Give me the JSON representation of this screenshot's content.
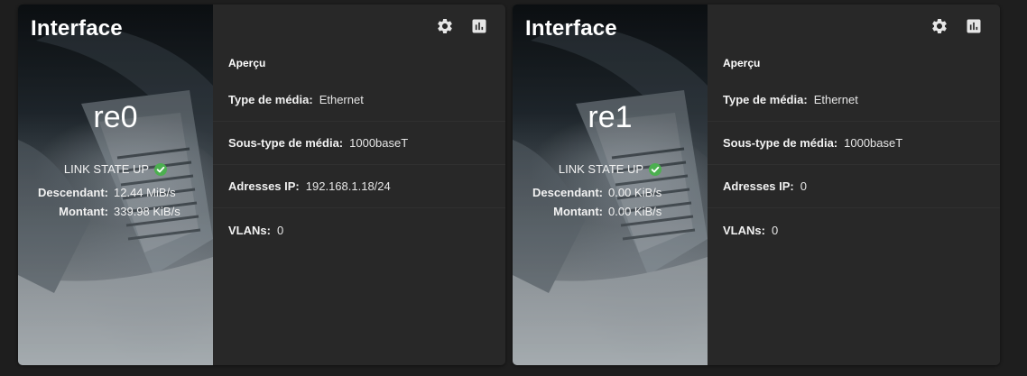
{
  "colors": {
    "page_bg": "#1e1e1e",
    "card_bg": "#282828",
    "text": "#e6e6e6",
    "link_up_green": "#4caf50",
    "icon": "#e6e6e6"
  },
  "cards": [
    {
      "title": "Interface",
      "name": "re0",
      "link_state": "LINK STATE UP",
      "download_label": "Descendant:",
      "download_value": "12.44 MiB/s",
      "upload_label": "Montant:",
      "upload_value": "339.98 KiB/s",
      "settings_icon": "gear-icon",
      "reports_icon": "bar-chart-icon",
      "overview_title": "Aperçu",
      "media_type_label": "Type de média:",
      "media_type_value": "Ethernet",
      "media_subtype_label": "Sous-type de média:",
      "media_subtype_value": "1000baseT",
      "ip_label": "Adresses IP:",
      "ip_value": "192.168.1.18/24",
      "vlans_label": "VLANs:",
      "vlans_value": "0"
    },
    {
      "title": "Interface",
      "name": "re1",
      "link_state": "LINK STATE UP",
      "download_label": "Descendant:",
      "download_value": "0.00 KiB/s",
      "upload_label": "Montant:",
      "upload_value": "0.00 KiB/s",
      "settings_icon": "gear-icon",
      "reports_icon": "bar-chart-icon",
      "overview_title": "Aperçu",
      "media_type_label": "Type de média:",
      "media_type_value": "Ethernet",
      "media_subtype_label": "Sous-type de média:",
      "media_subtype_value": "1000baseT",
      "ip_label": "Adresses IP:",
      "ip_value": "0",
      "vlans_label": "VLANs:",
      "vlans_value": "0"
    }
  ]
}
